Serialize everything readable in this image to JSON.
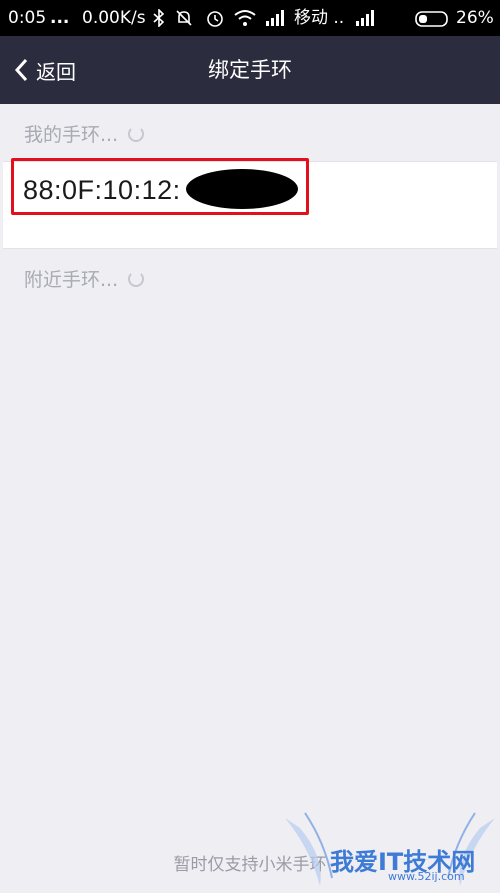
{
  "status_bar": {
    "time": "0:05",
    "dots": "...",
    "speed": "0.00K/s",
    "carrier": "移动 ..",
    "battery": "26%",
    "icons": [
      "bluetooth-icon",
      "mute-icon",
      "alarm-icon",
      "wifi-icon",
      "signal-icon",
      "battery-icon"
    ]
  },
  "nav": {
    "back_label": "返回",
    "title": "绑定手环"
  },
  "my_bands": {
    "label": "我的手环..."
  },
  "device": {
    "mac_visible": "88:0F:10:12:"
  },
  "nearby": {
    "label": "附近手环..."
  },
  "footer": {
    "note": "暂时仅支持小米手环"
  },
  "watermark": {
    "text": "我爱IT技术网",
    "url": "www.52ij.com"
  },
  "colors": {
    "navbar": "#2b2d3e",
    "highlight": "#e2101d",
    "background": "#eeeef3"
  }
}
